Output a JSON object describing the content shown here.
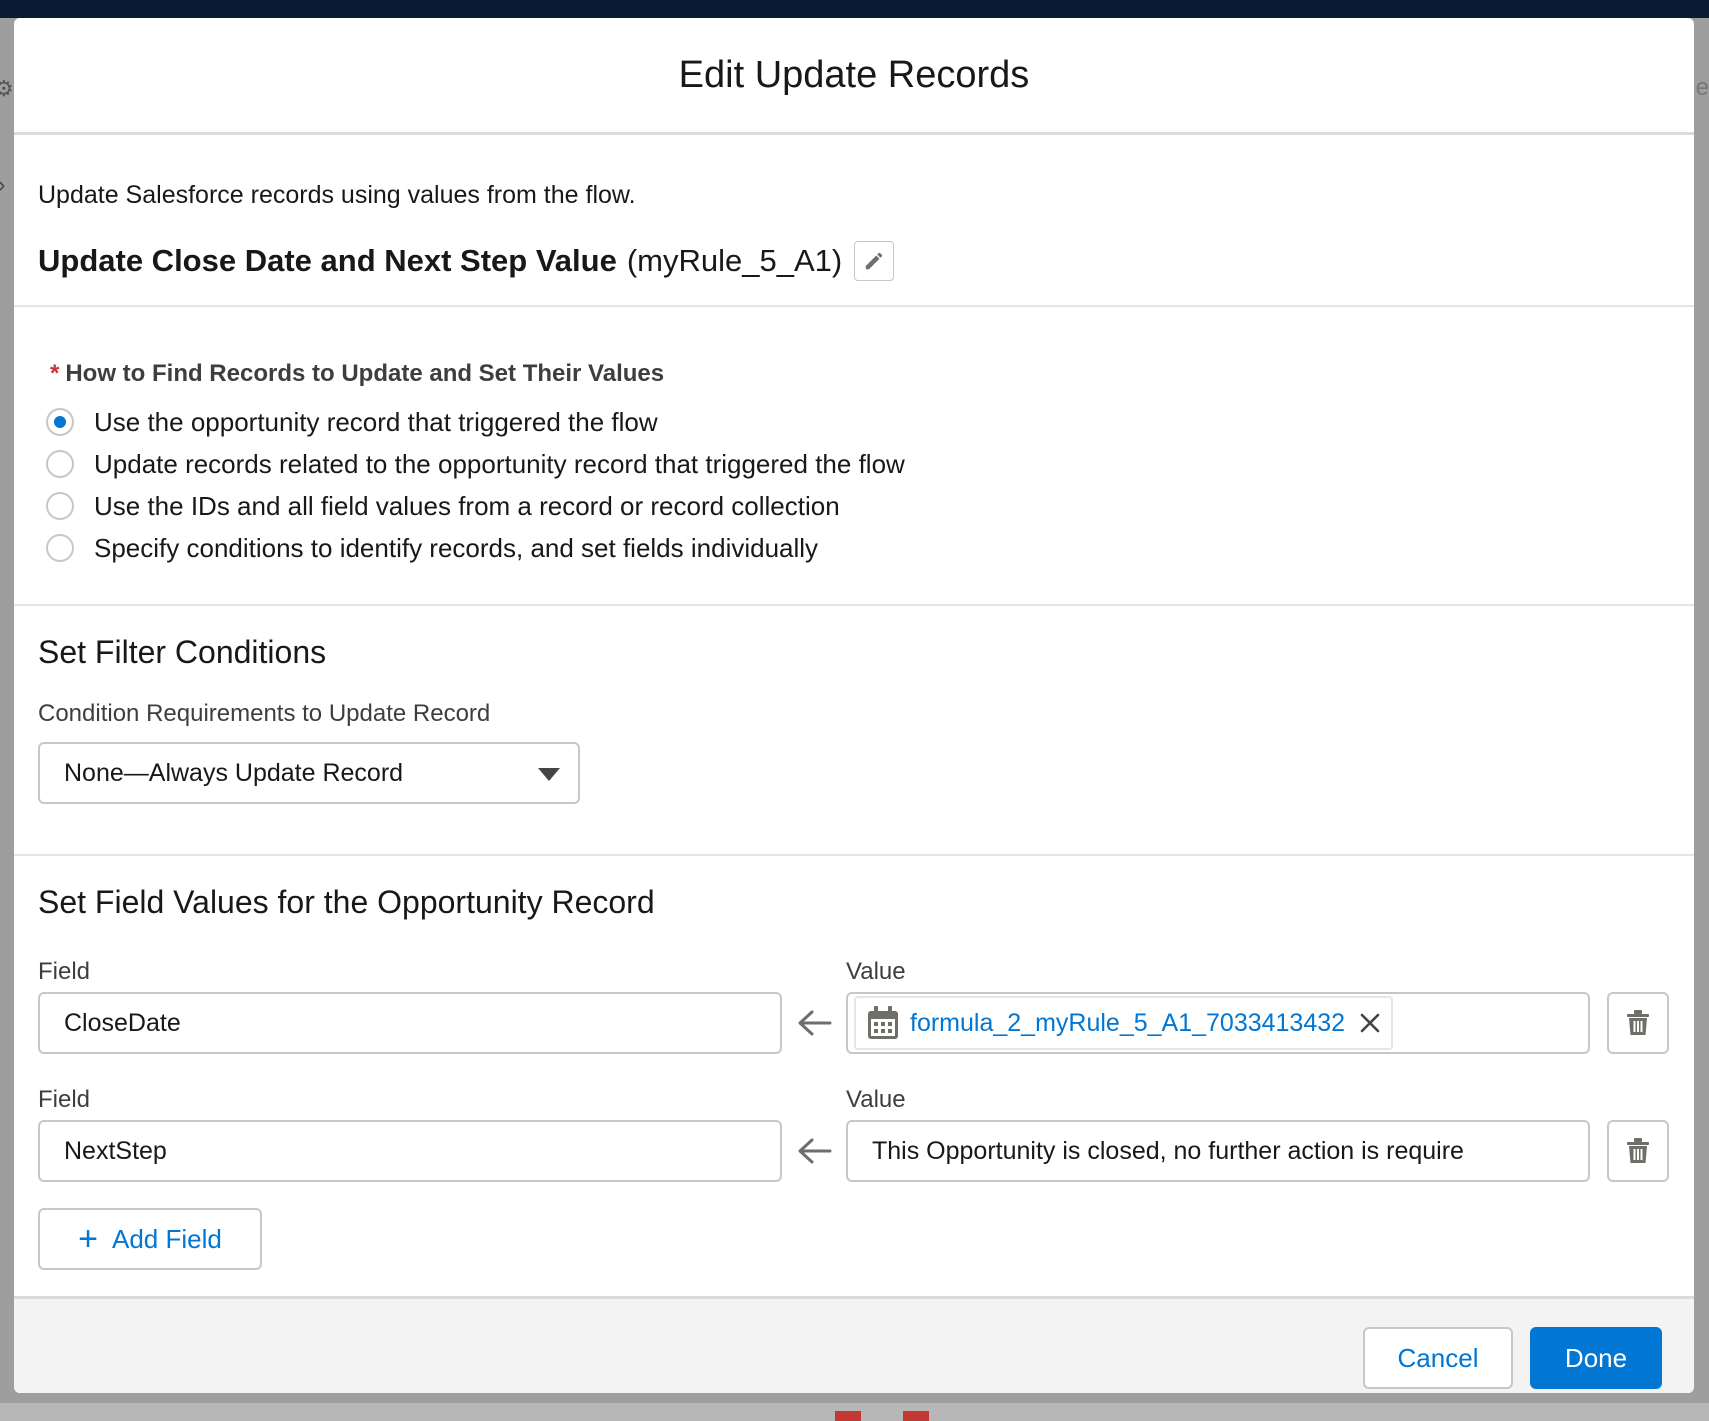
{
  "modal": {
    "title": "Edit Update Records",
    "description": "Update Salesforce records using values from the flow.",
    "element_label": "Update Close Date and Next Step Value",
    "element_api_name": "(myRule_5_A1)"
  },
  "how_to_find": {
    "required_marker": "*",
    "label": "How to Find Records to Update and Set Their Values",
    "options": [
      {
        "label": "Use the opportunity record that triggered the flow",
        "selected": true
      },
      {
        "label": "Update records related to the opportunity record that triggered the flow",
        "selected": false
      },
      {
        "label": "Use the IDs and all field values from a record or record collection",
        "selected": false
      },
      {
        "label": "Specify conditions to identify records, and set fields individually",
        "selected": false
      }
    ]
  },
  "filter": {
    "title": "Set Filter Conditions",
    "condition_label": "Condition Requirements to Update Record",
    "condition_value": "None—Always Update Record"
  },
  "field_values": {
    "title": "Set Field Values for the Opportunity Record",
    "rows": [
      {
        "field_label": "Field",
        "field_value": "CloseDate",
        "value_label": "Value",
        "value": "formula_2_myRule_5_A1_7033413432",
        "value_is_resource": true
      },
      {
        "field_label": "Field",
        "field_value": "NextStep",
        "value_label": "Value",
        "value": "This Opportunity is closed, no further action is require",
        "value_is_resource": false
      }
    ],
    "add_field_label": "Add Field"
  },
  "footer": {
    "cancel_label": "Cancel",
    "done_label": "Done"
  },
  "colors": {
    "brand": "#0176d3",
    "required": "#c23934",
    "header_bar": "#0b1a33"
  },
  "background": {
    "partial_letter": "e"
  }
}
